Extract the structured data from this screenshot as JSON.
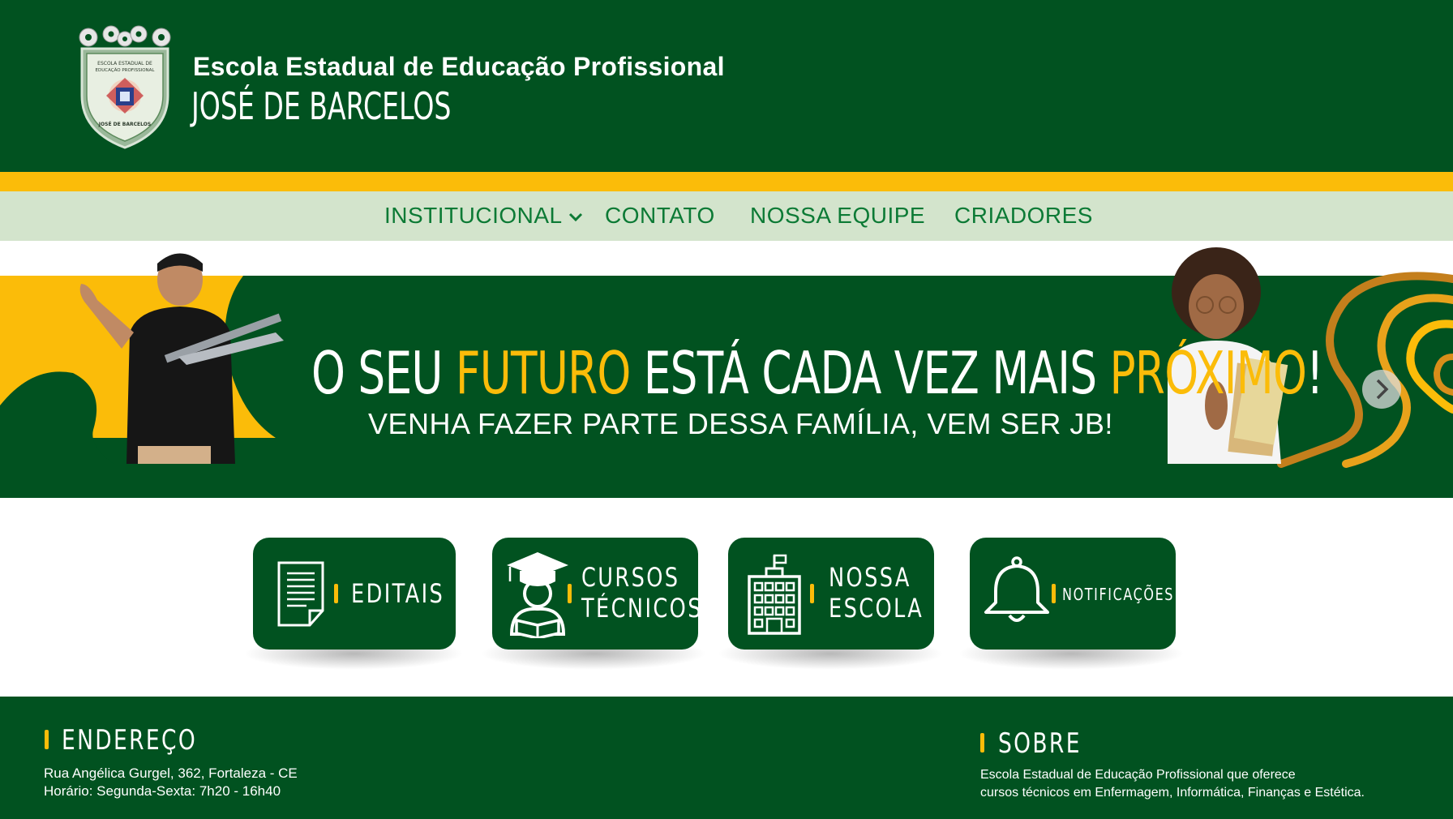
{
  "header": {
    "school_subtitle": "Escola Estadual de Educação Profissional",
    "school_name": "JOSÉ DE BARCELOS",
    "logo": {
      "line1": "ESCOLA ESTADUAL DE",
      "line2": "EDUCAÇÃO PROFISSIONAL",
      "name": "JOSÉ DE BARCELOS"
    }
  },
  "nav": {
    "items": [
      {
        "label": "INSTITUCIONAL",
        "has_dropdown": true
      },
      {
        "label": "CONTATO"
      },
      {
        "label": "NOSSA EQUIPE"
      },
      {
        "label": "CRIADORES"
      }
    ]
  },
  "hero": {
    "headline_part1": "O SEU ",
    "headline_highlight1": "FUTURO",
    "headline_part2": " ESTÁ CADA VEZ MAIS ",
    "headline_highlight2": "PRÓXIMO",
    "headline_part3": "!",
    "subline": "VENHA FAZER PARTE DESSA FAMÍLIA, VEM SER JB!",
    "next_icon": "chevron-right-icon"
  },
  "cards": [
    {
      "label": "EDITAIS",
      "icon": "document-icon"
    },
    {
      "label_line1": "CURSOS",
      "label_line2": "TÉCNICOS",
      "icon": "graduate-icon"
    },
    {
      "label_line1": "NOSSA",
      "label_line2": "ESCOLA",
      "icon": "building-icon"
    },
    {
      "label": "NOTIFICAÇÕES",
      "icon": "bell-icon"
    }
  ],
  "footer": {
    "address_title": "ENDEREÇO",
    "address_line": "Rua Angélica Gurgel, 362, Fortaleza - CE",
    "hours_line": "Horário: Segunda-Sexta: 7h20 - 16h40",
    "about_title": "SOBRE",
    "about_line1": "Escola Estadual de Educação Profissional que oferece",
    "about_line2": "cursos técnicos em Enfermagem, Informática, Finanças e Estética."
  },
  "colors": {
    "primary_green": "#015220",
    "accent_yellow": "#fbbc09",
    "nav_background": "#d3e4cc",
    "nav_text": "#0c7a35"
  }
}
